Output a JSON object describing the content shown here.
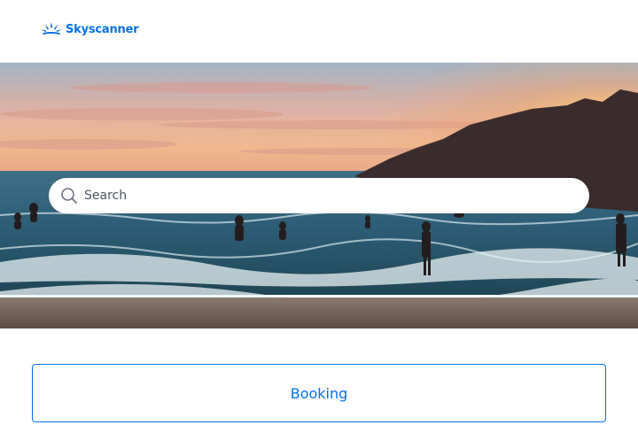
{
  "header": {
    "logo_text": "Skyscanner",
    "brand_color": "#0770e3"
  },
  "hero": {
    "image": "beach-sunset-photo",
    "search": {
      "placeholder": "Search",
      "value": "",
      "icon": "search-icon"
    }
  },
  "booking_button": {
    "label": "Booking"
  }
}
